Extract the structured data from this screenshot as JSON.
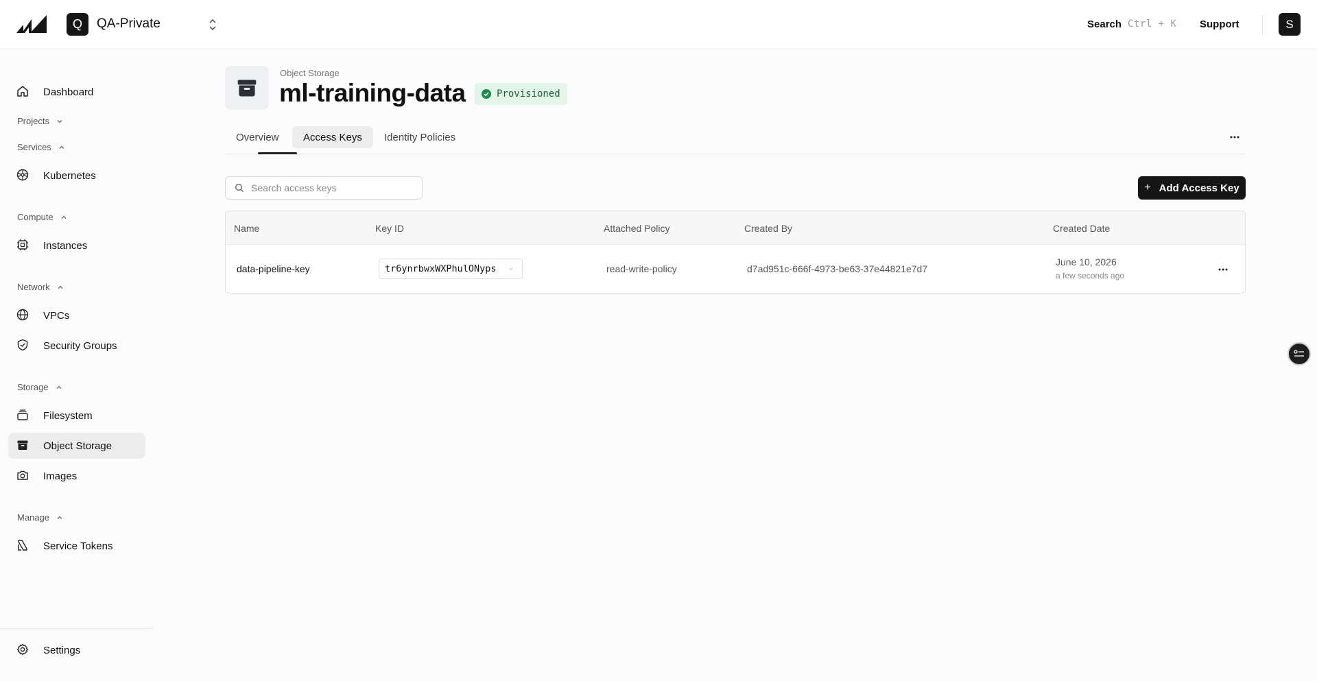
{
  "topbar": {
    "project_initial": "Q",
    "project_name": "QA-Private",
    "search_label": "Search",
    "search_shortcut": "Ctrl + K",
    "support_label": "Support",
    "avatar_initial": "S"
  },
  "sidebar": {
    "dashboard": "Dashboard",
    "sections": {
      "projects": "Projects",
      "services": "Services",
      "compute": "Compute",
      "network": "Network",
      "storage": "Storage",
      "manage": "Manage"
    },
    "items": {
      "kubernetes": "Kubernetes",
      "instances": "Instances",
      "vpcs": "VPCs",
      "security_groups": "Security Groups",
      "filesystem": "Filesystem",
      "object_storage": "Object Storage",
      "images": "Images",
      "service_tokens": "Service Tokens"
    },
    "settings": "Settings"
  },
  "header": {
    "overline": "Object Storage",
    "title": "ml-training-data",
    "status": "Provisioned",
    "status_color": "#1f5e36"
  },
  "tabs": [
    "Overview",
    "Access Keys",
    "Identity Policies"
  ],
  "toolbar": {
    "search_placeholder": "Search access keys",
    "add_label": "Add Access Key"
  },
  "table": {
    "columns": [
      "Name",
      "Key ID",
      "Attached Policy",
      "Created By",
      "Created Date"
    ],
    "rows": [
      {
        "name": "data-pipeline-key",
        "key_id": "tr6ynrbwxWXPhulONyps",
        "policy": "read-write-policy",
        "created_by": "d7ad951c-666f-4973-be63-37e44821e7d7",
        "created_date": "June 10, 2026",
        "created_relative": "a few seconds ago"
      }
    ]
  }
}
